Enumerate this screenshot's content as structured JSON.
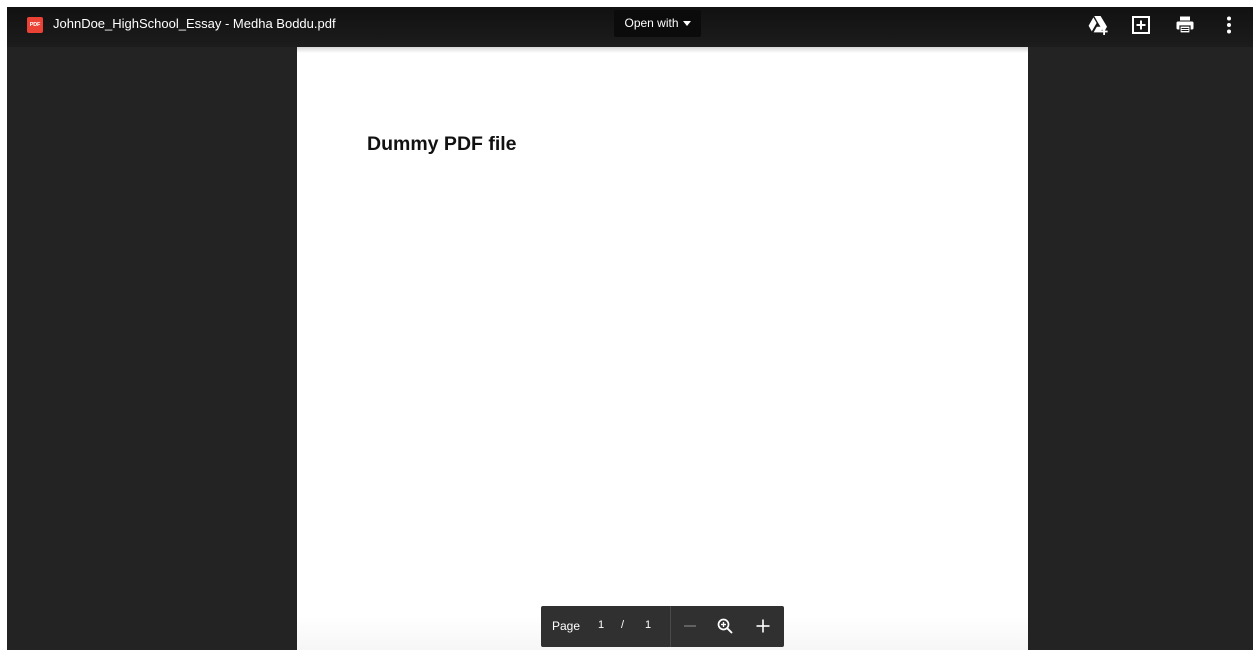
{
  "topbar": {
    "file_badge": "PDF",
    "file_title": "JohnDoe_HighSchool_Essay - Medha Boddu.pdf",
    "open_with_label": "Open with",
    "icons": [
      "add-to-drive-icon",
      "add-comment-icon",
      "print-icon",
      "more-options-icon"
    ]
  },
  "document": {
    "heading": "Dummy PDF file"
  },
  "page_controls": {
    "page_label": "Page",
    "current_page": "1",
    "separator": "/",
    "total_pages": "1",
    "icons": [
      "zoom-out-icon",
      "zoom-fit-icon",
      "zoom-in-icon"
    ]
  },
  "colors": {
    "background": "#232323",
    "toolbar": "#111111",
    "page": "#ffffff",
    "pdf_badge": "#ea4335",
    "controls": "#303030"
  }
}
